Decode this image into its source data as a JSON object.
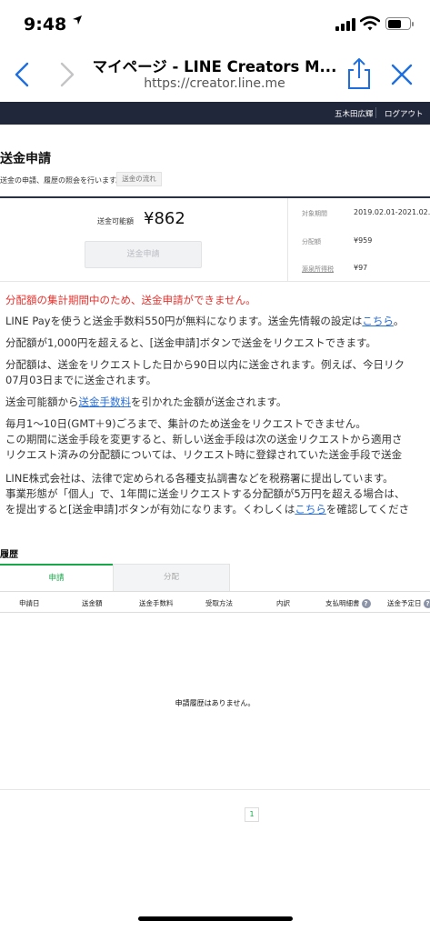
{
  "status_bar": {
    "time": "9:48",
    "location_icon": "location-arrow-icon"
  },
  "browser": {
    "page_title": "マイページ - LINE Creators M...",
    "url": "https://creator.line.me"
  },
  "site_header": {
    "user_name": "五木田広輝",
    "logout": "ログアウト"
  },
  "page": {
    "title": "送金申請",
    "description": "送金の申請、履歴の照会を行います。",
    "flow_button": "送金の流れ"
  },
  "summary": {
    "available_label": "送金可能額",
    "available_value": "¥862",
    "send_button": "送金申請",
    "period_label": "対象期間",
    "period_value": "2019.02.01-2021.02.",
    "distribution_label": "分配額",
    "distribution_value": "¥959",
    "tax_label": "源泉所得税",
    "tax_value": "¥97"
  },
  "notice": "分配額の集計期間中のため、送金申請ができません。",
  "paragraphs": {
    "line_pay_text": "LINE Payを使うと送金手数料550円が無料になります。送金先情報の設定は",
    "line_pay_link": "こちら",
    "line_pay_end": "。",
    "p2": "分配額が1,000円を超えると、[送金申請]ボタンで送金をリクエストできます。",
    "p3a": "分配額は、送金をリクエストした日から90日以内に送金されます。例えば、今日リク",
    "p3b": "07月03日までに送金されます。",
    "p4a": "送金可能額から",
    "p4link": "送金手数料",
    "p4b": "を引かれた金額が送金されます。",
    "p5a": "毎月1〜10日(GMT＋9)ごろまで、集計のため送金をリクエストできません。",
    "p5b": "この期間に送金手段を変更すると、新しい送金手段は次の送金リクエストから適用さ",
    "p5c": "リクエスト済みの分配額については、リクエスト時に登録されていた送金手段で送金",
    "p6a": "LINE株式会社は、法律で定められる各種支払調書などを税務署に提出しています。",
    "p6b": "事業形態が「個人」で、1年間に送金リクエストする分配額が5万円を超える場合は、",
    "p6c": "を提出すると[送金申請]ボタンが有効になります。くわしくは",
    "p6link": "こちら",
    "p6d": "を確認してくださ"
  },
  "history": {
    "title": "履歴",
    "tabs": [
      "申請",
      "分配"
    ],
    "columns": [
      "申請日",
      "送金額",
      "送金手数料",
      "受取方法",
      "内訳",
      "支払明細書",
      "送金予定日"
    ],
    "empty_message": "申請履歴はありません。",
    "current_page": "1"
  },
  "colors": {
    "header_bg": "#21273a",
    "accent_green": "#18a84a",
    "notice_red": "#e5322d",
    "link_blue": "#2a6fd6"
  }
}
